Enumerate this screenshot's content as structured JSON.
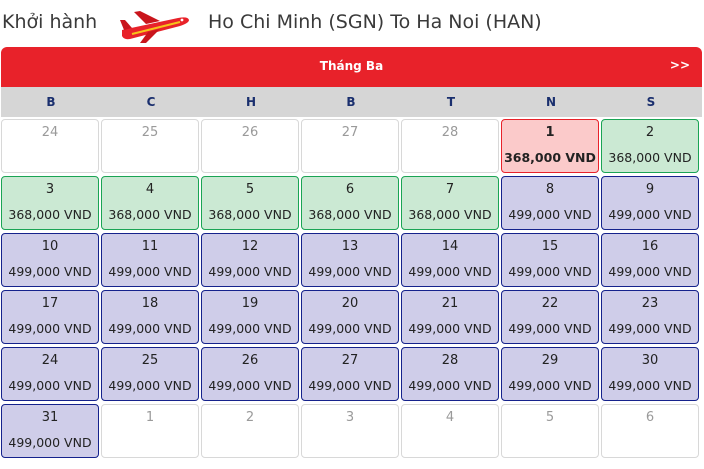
{
  "header": {
    "label": "Khởi hành",
    "route": "Ho Chi Minh (SGN) To Ha Noi (HAN)"
  },
  "calendar": {
    "month": "Tháng Ba",
    "next_label": ">>",
    "weekdays": [
      "B",
      "C",
      "H",
      "B",
      "T",
      "N",
      "S"
    ],
    "colors": {
      "header_red": "#e8222a",
      "low_fare_green": "#cbe9d3",
      "fare_purple": "#cfcde9",
      "selected_red": "#fbcaca"
    },
    "days": [
      {
        "day": "24",
        "price": "",
        "status": "out"
      },
      {
        "day": "25",
        "price": "",
        "status": "out"
      },
      {
        "day": "26",
        "price": "",
        "status": "out"
      },
      {
        "day": "27",
        "price": "",
        "status": "out"
      },
      {
        "day": "28",
        "price": "",
        "status": "out"
      },
      {
        "day": "1",
        "price": "368,000 VND",
        "status": "red"
      },
      {
        "day": "2",
        "price": "368,000 VND",
        "status": "green"
      },
      {
        "day": "3",
        "price": "368,000 VND",
        "status": "green"
      },
      {
        "day": "4",
        "price": "368,000 VND",
        "status": "green"
      },
      {
        "day": "5",
        "price": "368,000 VND",
        "status": "green"
      },
      {
        "day": "6",
        "price": "368,000 VND",
        "status": "green"
      },
      {
        "day": "7",
        "price": "368,000 VND",
        "status": "green"
      },
      {
        "day": "8",
        "price": "499,000 VND",
        "status": "purple"
      },
      {
        "day": "9",
        "price": "499,000 VND",
        "status": "purple"
      },
      {
        "day": "10",
        "price": "499,000 VND",
        "status": "purple"
      },
      {
        "day": "11",
        "price": "499,000 VND",
        "status": "purple"
      },
      {
        "day": "12",
        "price": "499,000 VND",
        "status": "purple"
      },
      {
        "day": "13",
        "price": "499,000 VND",
        "status": "purple"
      },
      {
        "day": "14",
        "price": "499,000 VND",
        "status": "purple"
      },
      {
        "day": "15",
        "price": "499,000 VND",
        "status": "purple"
      },
      {
        "day": "16",
        "price": "499,000 VND",
        "status": "purple"
      },
      {
        "day": "17",
        "price": "499,000 VND",
        "status": "purple"
      },
      {
        "day": "18",
        "price": "499,000 VND",
        "status": "purple"
      },
      {
        "day": "19",
        "price": "499,000 VND",
        "status": "purple"
      },
      {
        "day": "20",
        "price": "499,000 VND",
        "status": "purple"
      },
      {
        "day": "21",
        "price": "499,000 VND",
        "status": "purple"
      },
      {
        "day": "22",
        "price": "499,000 VND",
        "status": "purple"
      },
      {
        "day": "23",
        "price": "499,000 VND",
        "status": "purple"
      },
      {
        "day": "24",
        "price": "499,000 VND",
        "status": "purple"
      },
      {
        "day": "25",
        "price": "499,000 VND",
        "status": "purple"
      },
      {
        "day": "26",
        "price": "499,000 VND",
        "status": "purple"
      },
      {
        "day": "27",
        "price": "499,000 VND",
        "status": "purple"
      },
      {
        "day": "28",
        "price": "499,000 VND",
        "status": "purple"
      },
      {
        "day": "29",
        "price": "499,000 VND",
        "status": "purple"
      },
      {
        "day": "30",
        "price": "499,000 VND",
        "status": "purple"
      },
      {
        "day": "31",
        "price": "499,000 VND",
        "status": "purple"
      },
      {
        "day": "1",
        "price": "",
        "status": "out"
      },
      {
        "day": "2",
        "price": "",
        "status": "out"
      },
      {
        "day": "3",
        "price": "",
        "status": "out"
      },
      {
        "day": "4",
        "price": "",
        "status": "out"
      },
      {
        "day": "5",
        "price": "",
        "status": "out"
      },
      {
        "day": "6",
        "price": "",
        "status": "out"
      }
    ]
  }
}
